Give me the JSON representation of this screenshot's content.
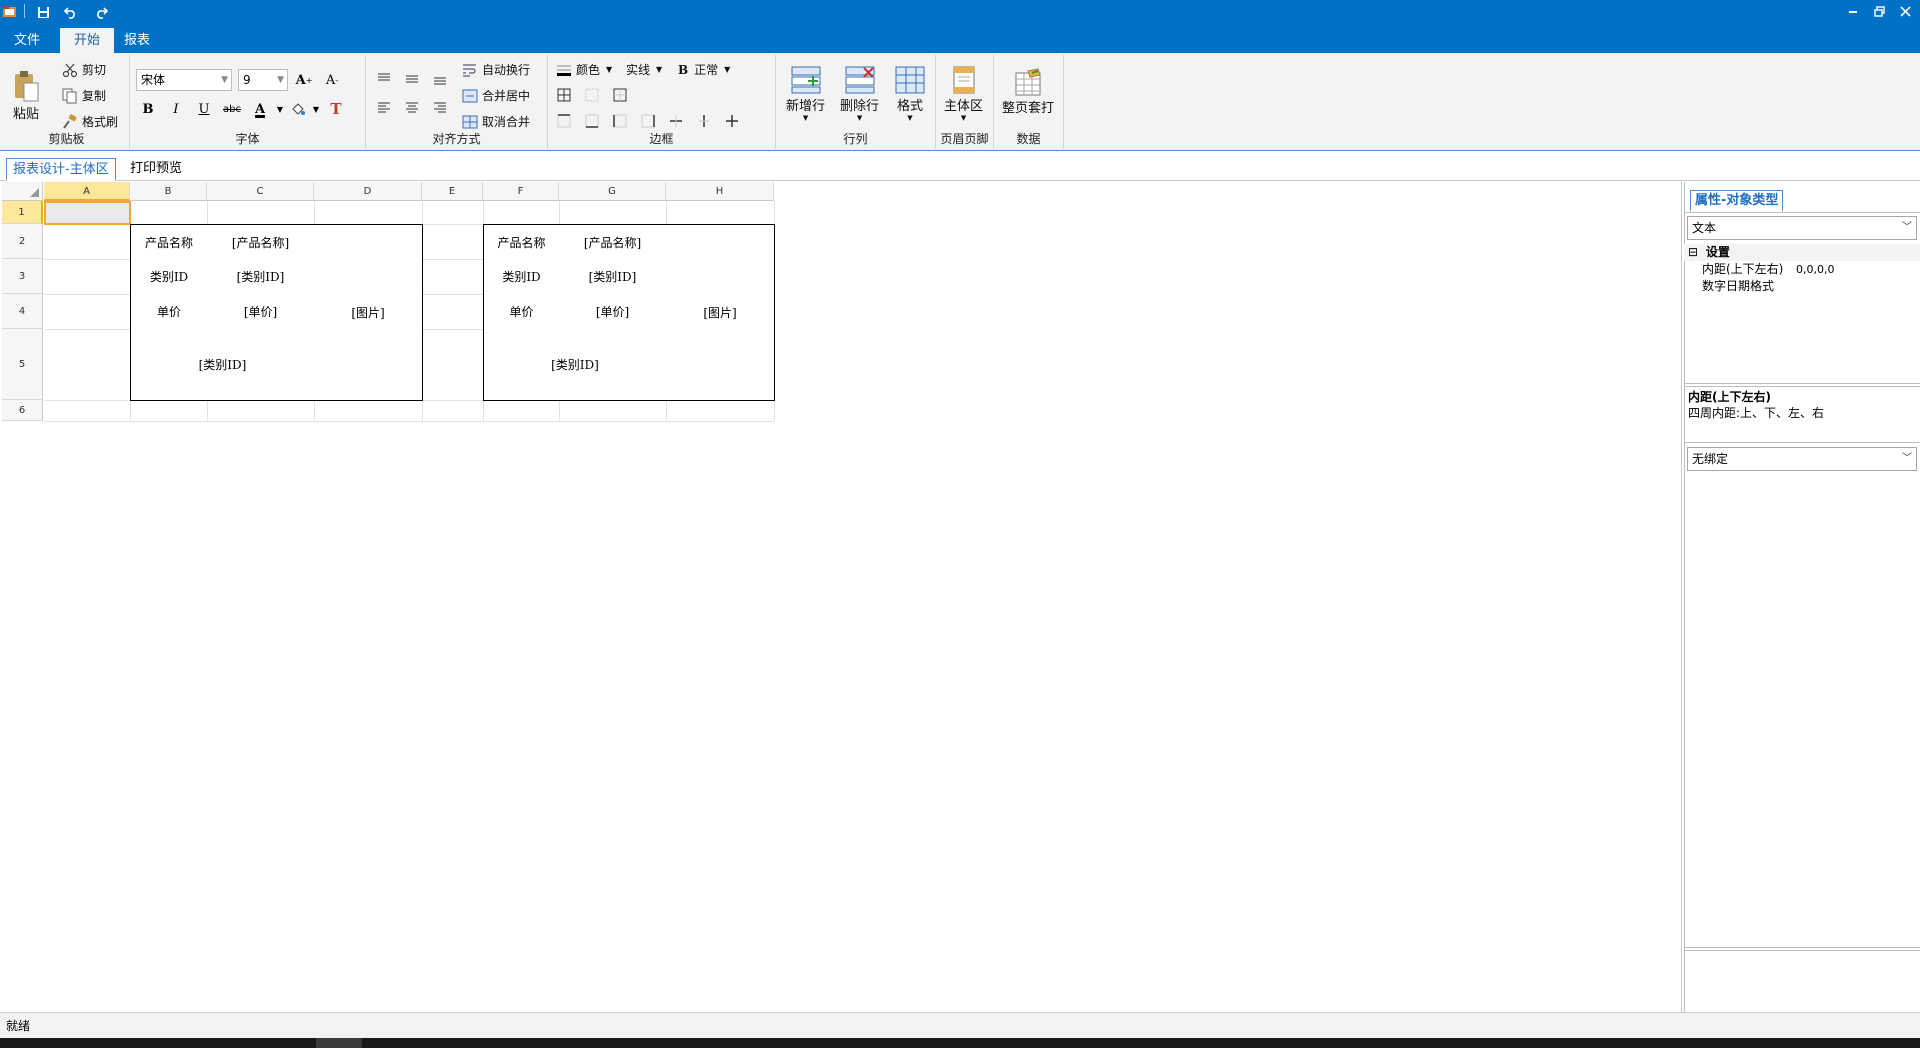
{
  "menu": {
    "file": "文件",
    "home": "开始",
    "report": "报表"
  },
  "ribbon": {
    "clipboard": {
      "label": "剪贴板",
      "paste": "粘贴",
      "cut": "剪切",
      "copy": "复制",
      "format_painter": "格式刷"
    },
    "font": {
      "label": "字体",
      "font_name": "宋体",
      "font_size": "9",
      "bold": "B",
      "italic": "I",
      "underline": "U",
      "strike": "abc",
      "font_color": "A",
      "clear": "T"
    },
    "align": {
      "label": "对齐方式",
      "wrap": "自动换行",
      "merge_center": "合并居中",
      "unmerge": "取消合并"
    },
    "border": {
      "label": "边框",
      "color": "颜色",
      "style": "实线",
      "weight_icon": "B",
      "weight": "正常"
    },
    "rowcol": {
      "label": "行列",
      "add_row": "新增行",
      "delete_row": "删除行",
      "format": "格式"
    },
    "header_footer": {
      "label": "页眉页脚",
      "main_area": "主体区"
    },
    "data": {
      "label": "数据",
      "full_page_print": "整页套打"
    }
  },
  "doc_tabs": {
    "design": "报表设计-主体区",
    "preview": "打印预览"
  },
  "grid": {
    "columns": [
      "A",
      "B",
      "C",
      "D",
      "E",
      "F",
      "G",
      "H"
    ],
    "rows": [
      "1",
      "2",
      "3",
      "4",
      "5",
      "6"
    ],
    "left_block": {
      "b2": "产品名称",
      "c2": "[产品名称]",
      "b3": "类别ID",
      "c3": "[类别ID]",
      "b4": "单价",
      "c4": "[单价]",
      "b5": "[类别ID]",
      "d": "[图片]"
    },
    "right_block": {
      "f2": "产品名称",
      "g2": "[产品名称]",
      "f3": "类别ID",
      "g3": "[类别ID]",
      "f4": "单价",
      "g4": "[单价]",
      "f5": "[类别ID]",
      "h": "[图片]"
    }
  },
  "properties": {
    "tab": "属性-对象类型",
    "object_type": "文本",
    "section": "设置",
    "section_toggle": "⊟",
    "padding_label": "内距(上下左右)",
    "padding_value": "0,0,0,0",
    "date_format_label": "数字日期格式",
    "desc_title": "内距(上下左右)",
    "desc_text": "四周内距:上、下、左、右",
    "binding": "无绑定"
  },
  "status": {
    "text": "就绪"
  },
  "colors": {
    "title_blue": "#0072c6",
    "accent_orange": "#f0a830",
    "ribbon_bg": "#f3f3f3"
  }
}
